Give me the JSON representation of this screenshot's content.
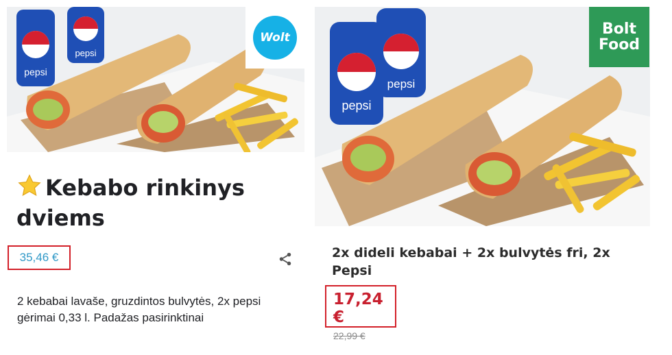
{
  "wolt_listing": {
    "logo_text": "Wolt",
    "star_icon": "star-emoji",
    "title": "Kebabo rinkinys dviems",
    "price": "35,46 €",
    "description": "2 kebabai lavaše, gruzdintos bulvytės, 2x pepsi gėrimai 0,33 l. Padažas pasirinktinai",
    "accent_color": "#2f98c7",
    "photo_can_text": "pepsi"
  },
  "bolt_listing": {
    "logo_line1": "Bolt",
    "logo_line2": "Food",
    "title": "2x dideli kebabai + 2x bulvytės fri, 2x Pepsi",
    "price": "17,24 €",
    "old_price": "22,99 €",
    "accent_color": "#c8202f",
    "photo_can_text": "pepsi"
  },
  "highlight_color": "#d31f28"
}
